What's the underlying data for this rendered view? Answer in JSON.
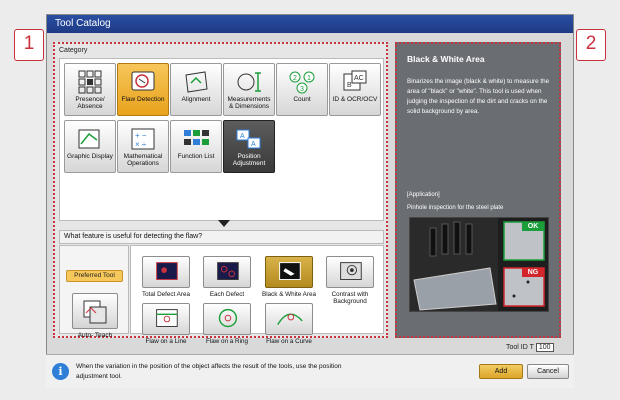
{
  "window": {
    "title": "Tool Catalog"
  },
  "callouts": [
    "1",
    "2"
  ],
  "category": {
    "label": "Category",
    "items": [
      {
        "label": "Presence/ Absence",
        "icon": "grid-squares-icon"
      },
      {
        "label": "Flaw Detection",
        "icon": "flaw-detection-icon",
        "selected": true
      },
      {
        "label": "Alignment",
        "icon": "alignment-icon"
      },
      {
        "label": "Measurements & Dimensions",
        "icon": "measurement-icon"
      },
      {
        "label": "Count",
        "icon": "count-icon"
      },
      {
        "label": "ID & OCR/OCV",
        "icon": "ocr-icon"
      },
      {
        "label": "Graphic Display",
        "icon": "graphic-display-icon"
      },
      {
        "label": "Mathematical Operations",
        "icon": "math-operations-icon"
      },
      {
        "label": "Function List",
        "icon": "function-list-icon"
      },
      {
        "label": "Position Adjustment",
        "icon": "position-adjustment-icon"
      }
    ]
  },
  "question": "What feature is useful for detecting the flaw?",
  "preferred": {
    "badge": "Preferred Tool",
    "autoteach_label": "Auto- Teach"
  },
  "tools": [
    {
      "label": "Total Defect Area"
    },
    {
      "label": "Each Defect"
    },
    {
      "label": "Black & White Area",
      "selected": true
    },
    {
      "label": "Contrast with Background"
    },
    {
      "label": "Flaw on a Line"
    },
    {
      "label": "Flaw on a Ring"
    },
    {
      "label": "Flaw on a Curve"
    }
  ],
  "detail": {
    "title": "Black & White Area",
    "description": "Binarizes the image (black & white) to measure the area of \"black\" or \"white\". This tool is used when judging the inspection of the dirt and cracks on the solid background by area.",
    "application_label": "[Application]",
    "application_text": "Pinhole inspection for the steel plate",
    "ok_label": "OK",
    "ng_label": "NG"
  },
  "tool_id": {
    "label": "Tool ID T",
    "value": "100"
  },
  "info": {
    "text": "When the variation in the position of the object affects the result of the tools, use the position adjustment tool."
  },
  "buttons": {
    "add": "Add",
    "cancel": "Cancel"
  },
  "colors": {
    "accent_red": "#c9323c",
    "selected_gold": "#e8a21d",
    "title_blue": "#1d3a85",
    "panel_gray": "#6a6d72"
  }
}
